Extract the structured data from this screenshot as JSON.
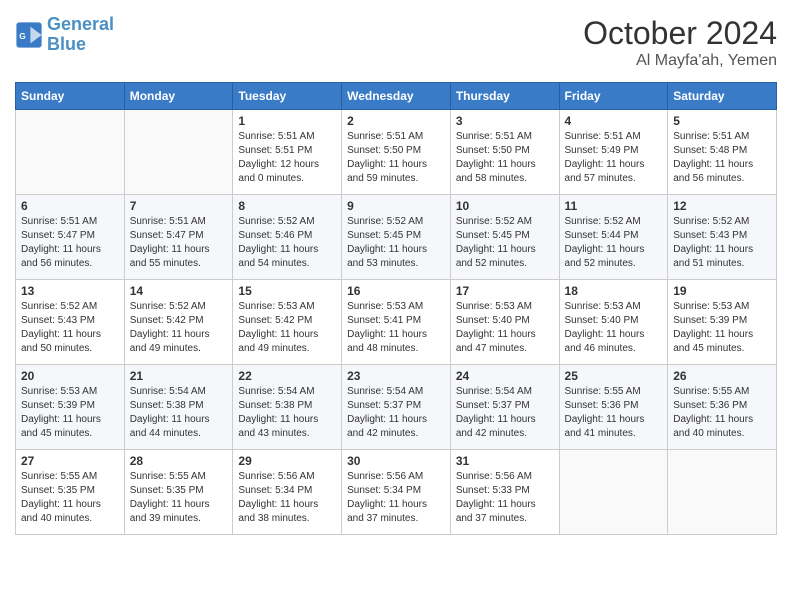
{
  "header": {
    "logo_line1": "General",
    "logo_line2": "Blue",
    "month": "October 2024",
    "location": "Al Mayfa'ah, Yemen"
  },
  "weekdays": [
    "Sunday",
    "Monday",
    "Tuesday",
    "Wednesday",
    "Thursday",
    "Friday",
    "Saturday"
  ],
  "weeks": [
    [
      {
        "day": "",
        "detail": ""
      },
      {
        "day": "",
        "detail": ""
      },
      {
        "day": "1",
        "detail": "Sunrise: 5:51 AM\nSunset: 5:51 PM\nDaylight: 12 hours\nand 0 minutes."
      },
      {
        "day": "2",
        "detail": "Sunrise: 5:51 AM\nSunset: 5:50 PM\nDaylight: 11 hours\nand 59 minutes."
      },
      {
        "day": "3",
        "detail": "Sunrise: 5:51 AM\nSunset: 5:50 PM\nDaylight: 11 hours\nand 58 minutes."
      },
      {
        "day": "4",
        "detail": "Sunrise: 5:51 AM\nSunset: 5:49 PM\nDaylight: 11 hours\nand 57 minutes."
      },
      {
        "day": "5",
        "detail": "Sunrise: 5:51 AM\nSunset: 5:48 PM\nDaylight: 11 hours\nand 56 minutes."
      }
    ],
    [
      {
        "day": "6",
        "detail": "Sunrise: 5:51 AM\nSunset: 5:47 PM\nDaylight: 11 hours\nand 56 minutes."
      },
      {
        "day": "7",
        "detail": "Sunrise: 5:51 AM\nSunset: 5:47 PM\nDaylight: 11 hours\nand 55 minutes."
      },
      {
        "day": "8",
        "detail": "Sunrise: 5:52 AM\nSunset: 5:46 PM\nDaylight: 11 hours\nand 54 minutes."
      },
      {
        "day": "9",
        "detail": "Sunrise: 5:52 AM\nSunset: 5:45 PM\nDaylight: 11 hours\nand 53 minutes."
      },
      {
        "day": "10",
        "detail": "Sunrise: 5:52 AM\nSunset: 5:45 PM\nDaylight: 11 hours\nand 52 minutes."
      },
      {
        "day": "11",
        "detail": "Sunrise: 5:52 AM\nSunset: 5:44 PM\nDaylight: 11 hours\nand 52 minutes."
      },
      {
        "day": "12",
        "detail": "Sunrise: 5:52 AM\nSunset: 5:43 PM\nDaylight: 11 hours\nand 51 minutes."
      }
    ],
    [
      {
        "day": "13",
        "detail": "Sunrise: 5:52 AM\nSunset: 5:43 PM\nDaylight: 11 hours\nand 50 minutes."
      },
      {
        "day": "14",
        "detail": "Sunrise: 5:52 AM\nSunset: 5:42 PM\nDaylight: 11 hours\nand 49 minutes."
      },
      {
        "day": "15",
        "detail": "Sunrise: 5:53 AM\nSunset: 5:42 PM\nDaylight: 11 hours\nand 49 minutes."
      },
      {
        "day": "16",
        "detail": "Sunrise: 5:53 AM\nSunset: 5:41 PM\nDaylight: 11 hours\nand 48 minutes."
      },
      {
        "day": "17",
        "detail": "Sunrise: 5:53 AM\nSunset: 5:40 PM\nDaylight: 11 hours\nand 47 minutes."
      },
      {
        "day": "18",
        "detail": "Sunrise: 5:53 AM\nSunset: 5:40 PM\nDaylight: 11 hours\nand 46 minutes."
      },
      {
        "day": "19",
        "detail": "Sunrise: 5:53 AM\nSunset: 5:39 PM\nDaylight: 11 hours\nand 45 minutes."
      }
    ],
    [
      {
        "day": "20",
        "detail": "Sunrise: 5:53 AM\nSunset: 5:39 PM\nDaylight: 11 hours\nand 45 minutes."
      },
      {
        "day": "21",
        "detail": "Sunrise: 5:54 AM\nSunset: 5:38 PM\nDaylight: 11 hours\nand 44 minutes."
      },
      {
        "day": "22",
        "detail": "Sunrise: 5:54 AM\nSunset: 5:38 PM\nDaylight: 11 hours\nand 43 minutes."
      },
      {
        "day": "23",
        "detail": "Sunrise: 5:54 AM\nSunset: 5:37 PM\nDaylight: 11 hours\nand 42 minutes."
      },
      {
        "day": "24",
        "detail": "Sunrise: 5:54 AM\nSunset: 5:37 PM\nDaylight: 11 hours\nand 42 minutes."
      },
      {
        "day": "25",
        "detail": "Sunrise: 5:55 AM\nSunset: 5:36 PM\nDaylight: 11 hours\nand 41 minutes."
      },
      {
        "day": "26",
        "detail": "Sunrise: 5:55 AM\nSunset: 5:36 PM\nDaylight: 11 hours\nand 40 minutes."
      }
    ],
    [
      {
        "day": "27",
        "detail": "Sunrise: 5:55 AM\nSunset: 5:35 PM\nDaylight: 11 hours\nand 40 minutes."
      },
      {
        "day": "28",
        "detail": "Sunrise: 5:55 AM\nSunset: 5:35 PM\nDaylight: 11 hours\nand 39 minutes."
      },
      {
        "day": "29",
        "detail": "Sunrise: 5:56 AM\nSunset: 5:34 PM\nDaylight: 11 hours\nand 38 minutes."
      },
      {
        "day": "30",
        "detail": "Sunrise: 5:56 AM\nSunset: 5:34 PM\nDaylight: 11 hours\nand 37 minutes."
      },
      {
        "day": "31",
        "detail": "Sunrise: 5:56 AM\nSunset: 5:33 PM\nDaylight: 11 hours\nand 37 minutes."
      },
      {
        "day": "",
        "detail": ""
      },
      {
        "day": "",
        "detail": ""
      }
    ]
  ]
}
